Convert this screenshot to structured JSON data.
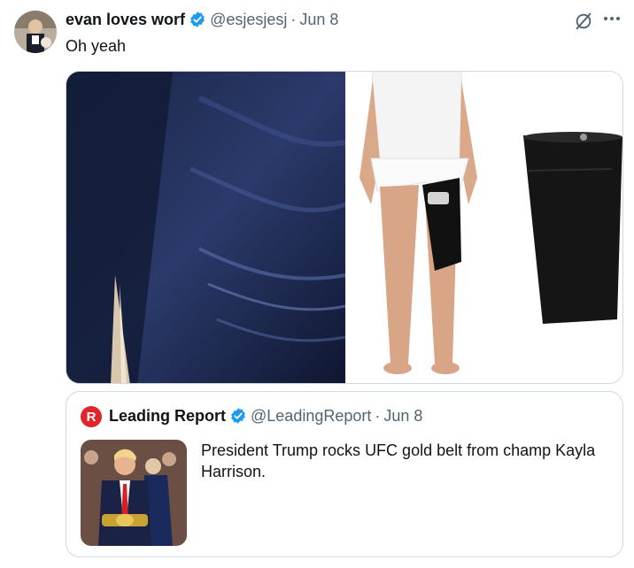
{
  "tweet": {
    "author_name": "evan loves worf",
    "handle": "@esjesjesj",
    "separator": "·",
    "date": "Jun 8",
    "text": "Oh yeah",
    "verified": true
  },
  "quoted_tweet": {
    "author_name": "Leading Report",
    "handle": "@LeadingReport",
    "separator": "·",
    "date": "Jun 8",
    "text": "President Trump rocks UFC gold belt from champ Kayla Harrison.",
    "verified": true,
    "logo_letter": "R"
  },
  "colors": {
    "verified_blue": "#1d9bf0",
    "secondary_text": "#536471",
    "border": "#cfd9de",
    "logo_red": "#e0262b"
  },
  "icons": {
    "more": "more-icon",
    "grok": "grok-icon",
    "verified": "verified-badge-icon"
  }
}
